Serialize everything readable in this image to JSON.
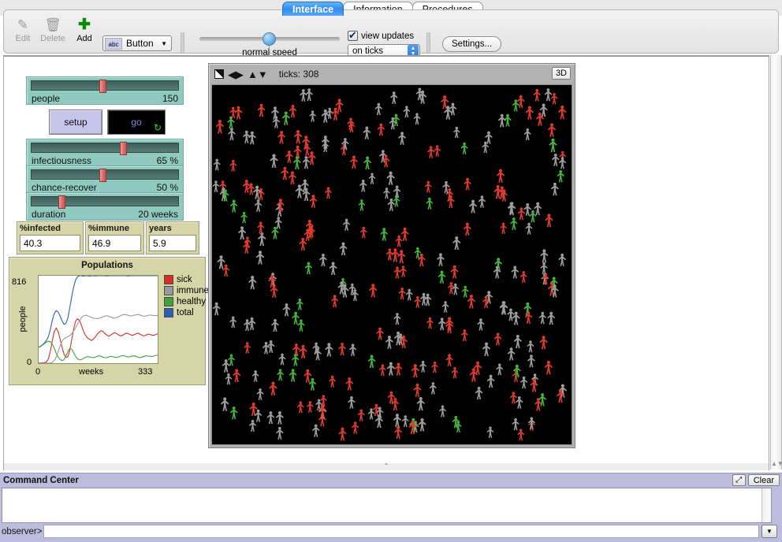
{
  "tabs": [
    {
      "label": "Interface",
      "active": true
    },
    {
      "label": "Information",
      "active": false
    },
    {
      "label": "Procedures",
      "active": false
    }
  ],
  "toolbar": {
    "edit_label": "Edit",
    "delete_label": "Delete",
    "add_label": "Add",
    "widget_type": "Button",
    "widget_icon": "abc",
    "speed_label": "normal speed",
    "speed_value": 50,
    "view_updates_label": "view updates",
    "view_updates_checked": true,
    "update_mode": "on ticks",
    "settings_label": "Settings..."
  },
  "sliders": [
    {
      "name": "people",
      "value": "150",
      "fill": 0.5
    },
    {
      "name": "infectiousness",
      "value": "65 %",
      "fill": 0.65
    },
    {
      "name": "chance-recover",
      "value": "50 %",
      "fill": 0.5
    },
    {
      "name": "duration",
      "value": "20 weeks",
      "fill": 0.195
    }
  ],
  "buttons": [
    {
      "label": "setup",
      "state": "idle",
      "forever": false
    },
    {
      "label": "go",
      "state": "running",
      "forever": true,
      "forever_icon": "↻"
    }
  ],
  "monitors": [
    {
      "title": "%infected",
      "value": "40.3"
    },
    {
      "title": "%immune",
      "value": "46.9"
    },
    {
      "title": "years",
      "value": "5.9"
    }
  ],
  "view": {
    "ticks_label": "ticks: 308",
    "button_3d": "3D",
    "icons": [
      "fill-toggle-icon",
      "horizontal-arrows-icon",
      "vertical-arrows-icon"
    ],
    "background": "#000000",
    "turtle_colors": {
      "sick": "#e03a2f",
      "immune": "#9e9e9e",
      "healthy": "#43b53a"
    },
    "turtle_counts": {
      "sick": 134,
      "immune": 156,
      "healthy": 43
    }
  },
  "command_center": {
    "title": "Command Center",
    "clear_label": "Clear",
    "expand_icon": "⤢",
    "prompt": "observer>",
    "input_value": "",
    "output": ""
  },
  "chart_data": {
    "type": "line",
    "title": "Populations",
    "xlabel": "weeks",
    "ylabel": "people",
    "xlim": [
      0,
      333
    ],
    "ylim": [
      0,
      816
    ],
    "xticks": [
      "0",
      "333"
    ],
    "yticks": [
      "0",
      "816"
    ],
    "grid": false,
    "legend_position": "right",
    "series": [
      {
        "name": "sick",
        "color": "#d92e26",
        "values": [
          2,
          2,
          3,
          5,
          12,
          40,
          110,
          210,
          295,
          330,
          300,
          230,
          150,
          88,
          55,
          60,
          120,
          220,
          320,
          390,
          410,
          395,
          350,
          300,
          262,
          240,
          228,
          215,
          225,
          245,
          268,
          288,
          300,
          292,
          272,
          258,
          250,
          262,
          278,
          288,
          280,
          268,
          258,
          262,
          272,
          280,
          272,
          262,
          256,
          262,
          272,
          278,
          270,
          262,
          258,
          266,
          275,
          272,
          264,
          260,
          266,
          272
        ]
      },
      {
        "name": "immune",
        "color": "#9a9a9a",
        "values": [
          0,
          0,
          0,
          0,
          0,
          0,
          2,
          8,
          25,
          60,
          110,
          165,
          205,
          228,
          238,
          245,
          255,
          272,
          298,
          330,
          368,
          400,
          428,
          445,
          452,
          448,
          438,
          428,
          420,
          415,
          412,
          415,
          422,
          430,
          438,
          442,
          440,
          432,
          426,
          424,
          428,
          436,
          444,
          450,
          452,
          448,
          442,
          438,
          440,
          446,
          452,
          456,
          452,
          446,
          442,
          444,
          448,
          450,
          446,
          442,
          440,
          442
        ]
      },
      {
        "name": "healthy",
        "color": "#3fa33a",
        "values": [
          148,
          155,
          168,
          182,
          196,
          205,
          200,
          178,
          140,
          95,
          58,
          35,
          22,
          30,
          62,
          105,
          135,
          128,
          96,
          62,
          42,
          35,
          38,
          48,
          58,
          62,
          58,
          52,
          48,
          52,
          60,
          66,
          62,
          56,
          52,
          55,
          62,
          68,
          64,
          58,
          54,
          58,
          64,
          68,
          64,
          58,
          55,
          60,
          66,
          70,
          66,
          60,
          56,
          60,
          66,
          70,
          66,
          62,
          58,
          62,
          68,
          72
        ]
      },
      {
        "name": "total",
        "color": "#2a5fb5",
        "values": [
          150,
          158,
          172,
          190,
          212,
          248,
          315,
          400,
          462,
          490,
          475,
          438,
          392,
          358,
          368,
          420,
          520,
          625,
          718,
          782,
          812,
          816,
          816,
          812,
          816,
          816,
          812,
          816,
          816,
          814,
          816,
          816,
          816,
          816,
          816,
          814,
          816,
          816,
          816,
          816,
          816,
          816,
          816,
          816,
          816,
          816,
          814,
          816,
          816,
          816,
          816,
          816,
          816,
          816,
          816,
          816,
          816,
          816,
          816,
          816,
          816,
          816
        ]
      }
    ]
  }
}
